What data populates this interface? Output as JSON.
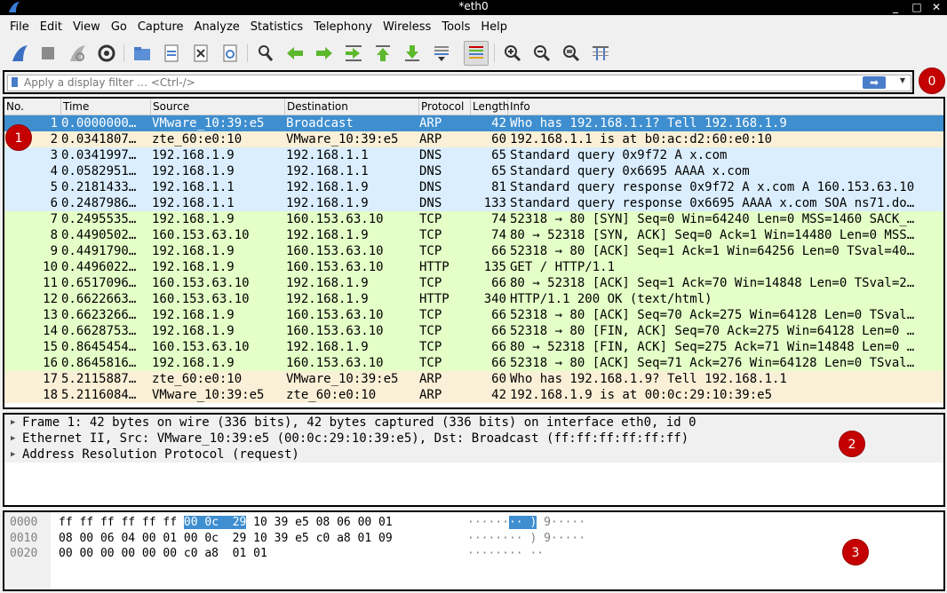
{
  "window": {
    "title": "*eth0"
  },
  "menu": [
    "File",
    "Edit",
    "View",
    "Go",
    "Capture",
    "Analyze",
    "Statistics",
    "Telephony",
    "Wireless",
    "Tools",
    "Help"
  ],
  "filter": {
    "placeholder": "Apply a display filter … <Ctrl-/>",
    "value": ""
  },
  "badges": [
    "0",
    "1",
    "2",
    "3"
  ],
  "columns": [
    "No.",
    "Time",
    "Source",
    "Destination",
    "Protocol",
    "Length",
    "Info"
  ],
  "colors": {
    "selected": "#3e8ed0",
    "arp": "#faf0d7",
    "dns": "#daeeff",
    "tcp": "#e7e6ff",
    "tcp_green": "#e4ffc7",
    "accent_red": "#c40000"
  },
  "packets": [
    {
      "no": "1",
      "time": "0.0000000…",
      "src": "VMware_10:39:e5",
      "dst": "Broadcast",
      "proto": "ARP",
      "len": "42",
      "info": "Who has 192.168.1.1? Tell 192.168.1.9",
      "row_color": "selected"
    },
    {
      "no": "2",
      "time": "0.0341807…",
      "src": "zte_60:e0:10",
      "dst": "VMware_10:39:e5",
      "proto": "ARP",
      "len": "60",
      "info": "192.168.1.1 is at b0:ac:d2:60:e0:10",
      "row_color": "arp"
    },
    {
      "no": "3",
      "time": "0.0341997…",
      "src": "192.168.1.9",
      "dst": "192.168.1.1",
      "proto": "DNS",
      "len": "65",
      "info": "Standard query 0x9f72 A x.com",
      "row_color": "dns"
    },
    {
      "no": "4",
      "time": "0.0582951…",
      "src": "192.168.1.9",
      "dst": "192.168.1.1",
      "proto": "DNS",
      "len": "65",
      "info": "Standard query 0x6695 AAAA x.com",
      "row_color": "dns"
    },
    {
      "no": "5",
      "time": "0.2181433…",
      "src": "192.168.1.1",
      "dst": "192.168.1.9",
      "proto": "DNS",
      "len": "81",
      "info": "Standard query response 0x9f72 A x.com A 160.153.63.10",
      "row_color": "dns"
    },
    {
      "no": "6",
      "time": "0.2487986…",
      "src": "192.168.1.1",
      "dst": "192.168.1.9",
      "proto": "DNS",
      "len": "133",
      "info": "Standard query response 0x6695 AAAA x.com SOA ns71.do…",
      "row_color": "dns"
    },
    {
      "no": "7",
      "time": "0.2495535…",
      "src": "192.168.1.9",
      "dst": "160.153.63.10",
      "proto": "TCP",
      "len": "74",
      "info": "52318 → 80 [SYN] Seq=0 Win=64240 Len=0 MSS=1460 SACK_…",
      "row_color": "tcp_green"
    },
    {
      "no": "8",
      "time": "0.4490502…",
      "src": "160.153.63.10",
      "dst": "192.168.1.9",
      "proto": "TCP",
      "len": "74",
      "info": "80 → 52318 [SYN, ACK] Seq=0 Ack=1 Win=14480 Len=0 MSS…",
      "row_color": "tcp_green"
    },
    {
      "no": "9",
      "time": "0.4491790…",
      "src": "192.168.1.9",
      "dst": "160.153.63.10",
      "proto": "TCP",
      "len": "66",
      "info": "52318 → 80 [ACK] Seq=1 Ack=1 Win=64256 Len=0 TSval=40…",
      "row_color": "tcp_green"
    },
    {
      "no": "10",
      "time": "0.4496022…",
      "src": "192.168.1.9",
      "dst": "160.153.63.10",
      "proto": "HTTP",
      "len": "135",
      "info": "GET / HTTP/1.1",
      "row_color": "tcp_green"
    },
    {
      "no": "11",
      "time": "0.6517096…",
      "src": "160.153.63.10",
      "dst": "192.168.1.9",
      "proto": "TCP",
      "len": "66",
      "info": "80 → 52318 [ACK] Seq=1 Ack=70 Win=14848 Len=0 TSval=2…",
      "row_color": "tcp_green"
    },
    {
      "no": "12",
      "time": "0.6622663…",
      "src": "160.153.63.10",
      "dst": "192.168.1.9",
      "proto": "HTTP",
      "len": "340",
      "info": "HTTP/1.1 200 OK  (text/html)",
      "row_color": "tcp_green"
    },
    {
      "no": "13",
      "time": "0.6623266…",
      "src": "192.168.1.9",
      "dst": "160.153.63.10",
      "proto": "TCP",
      "len": "66",
      "info": "52318 → 80 [ACK] Seq=70 Ack=275 Win=64128 Len=0 TSval…",
      "row_color": "tcp_green"
    },
    {
      "no": "14",
      "time": "0.6628753…",
      "src": "192.168.1.9",
      "dst": "160.153.63.10",
      "proto": "TCP",
      "len": "66",
      "info": "52318 → 80 [FIN, ACK] Seq=70 Ack=275 Win=64128 Len=0 …",
      "row_color": "tcp_green"
    },
    {
      "no": "15",
      "time": "0.8645454…",
      "src": "160.153.63.10",
      "dst": "192.168.1.9",
      "proto": "TCP",
      "len": "66",
      "info": "80 → 52318 [FIN, ACK] Seq=275 Ack=71 Win=14848 Len=0 …",
      "row_color": "tcp_green"
    },
    {
      "no": "16",
      "time": "0.8645816…",
      "src": "192.168.1.9",
      "dst": "160.153.63.10",
      "proto": "TCP",
      "len": "66",
      "info": "52318 → 80 [ACK] Seq=71 Ack=276 Win=64128 Len=0 TSval…",
      "row_color": "tcp_green"
    },
    {
      "no": "17",
      "time": "5.2115887…",
      "src": "zte_60:e0:10",
      "dst": "VMware_10:39:e5",
      "proto": "ARP",
      "len": "60",
      "info": "Who has 192.168.1.9? Tell 192.168.1.1",
      "row_color": "arp"
    },
    {
      "no": "18",
      "time": "5.2116084…",
      "src": "VMware_10:39:e5",
      "dst": "zte_60:e0:10",
      "proto": "ARP",
      "len": "42",
      "info": "192.168.1.9 is at 00:0c:29:10:39:e5",
      "row_color": "arp"
    }
  ],
  "details": [
    "Frame 1: 42 bytes on wire (336 bits), 42 bytes captured (336 bits) on interface eth0, id 0",
    "Ethernet II, Src: VMware_10:39:e5 (00:0c:29:10:39:e5), Dst: Broadcast (ff:ff:ff:ff:ff:ff)",
    "Address Resolution Protocol (request)"
  ],
  "bytes": [
    {
      "offset": "0000",
      "hex_a": "ff ff ff ff ff ff ",
      "hex_hl": "00 0c  29",
      "hex_b": " 10 39 e5 08 06 00 01",
      "asc_a": "······",
      "asc_hl": "·· )",
      "asc_b": " 9·····"
    },
    {
      "offset": "0010",
      "hex_a": "08 00 06 04 00 01 00 0c  29 10 39 e5 c0 a8 01 09",
      "hex_hl": "",
      "hex_b": "",
      "asc_a": "········ ) 9·····",
      "asc_hl": "",
      "asc_b": ""
    },
    {
      "offset": "0020",
      "hex_a": "00 00 00 00 00 00 c0 a8  01 01",
      "hex_hl": "",
      "hex_b": "",
      "asc_a": "········ ··",
      "asc_hl": "",
      "asc_b": ""
    }
  ]
}
